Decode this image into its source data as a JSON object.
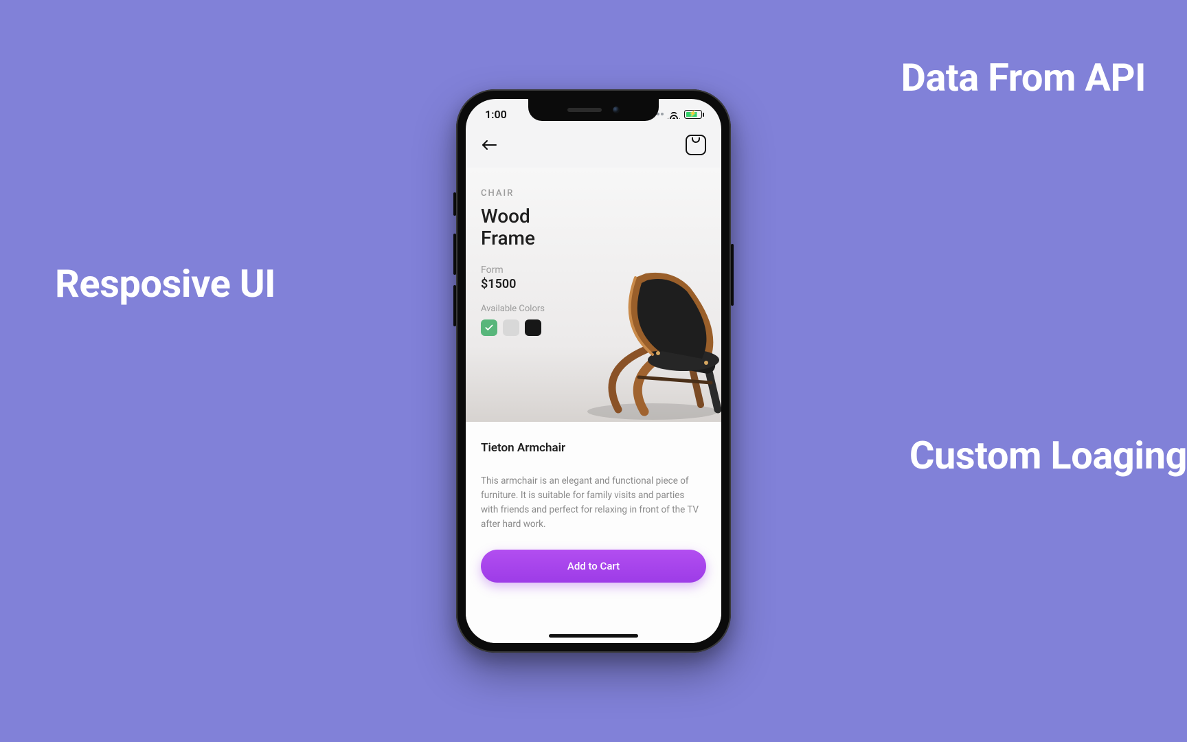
{
  "annotations": {
    "left": "Resposive UI",
    "top_right": "Data From API",
    "bottom_right": "Custom Loaging"
  },
  "status": {
    "time": "1:00"
  },
  "product": {
    "category": "CHAIR",
    "name_line1": "Wood",
    "name_line2": "Frame",
    "form_label": "Form",
    "price": "$1500",
    "colors_label": "Available Colors",
    "colors": [
      {
        "name": "green",
        "hex": "#58b67b",
        "selected": true
      },
      {
        "name": "grey",
        "hex": "#d8d8d8",
        "selected": false
      },
      {
        "name": "black",
        "hex": "#171717",
        "selected": false
      }
    ],
    "detail_title": "Tieton Armchair",
    "detail_description": "This armchair is an elegant and functional piece of furniture. It is suitable for family visits and parties with friends and perfect for relaxing in front of the TV after hard work.",
    "cta": "Add to Cart"
  }
}
